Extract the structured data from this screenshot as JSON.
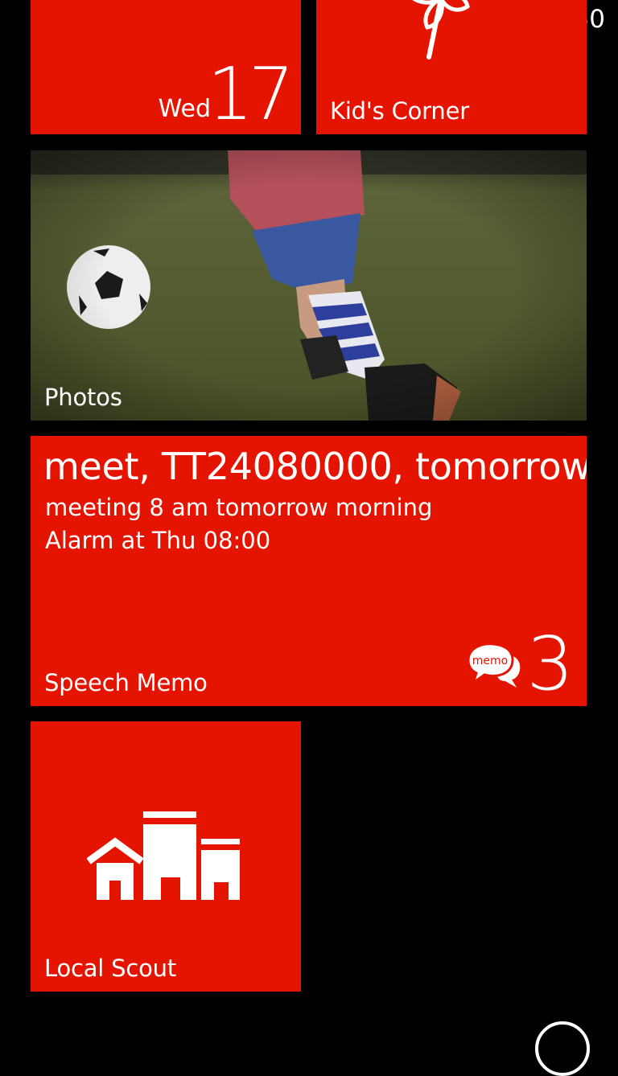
{
  "status_bar": {
    "time": "7:50",
    "battery_icon": "battery-charging-icon"
  },
  "tiles": {
    "calendar": {
      "day": "Wed",
      "date": "17"
    },
    "kids_corner": {
      "label": "Kid's Corner",
      "icon": "pinwheel-icon"
    },
    "photos": {
      "label": "Photos"
    },
    "speech_memo": {
      "title": "meet, TT24080000, tomorrow,",
      "line1": "meeting 8 am tomorrow morning",
      "line2": "Alarm at Thu 08:00",
      "icon_text": "memo",
      "count": "3",
      "label": "Speech Memo"
    },
    "local_scout": {
      "label": "Local Scout",
      "icon": "buildings-icon"
    }
  },
  "colors": {
    "accent": "#e51400",
    "background": "#000000",
    "text": "#ffffff"
  }
}
